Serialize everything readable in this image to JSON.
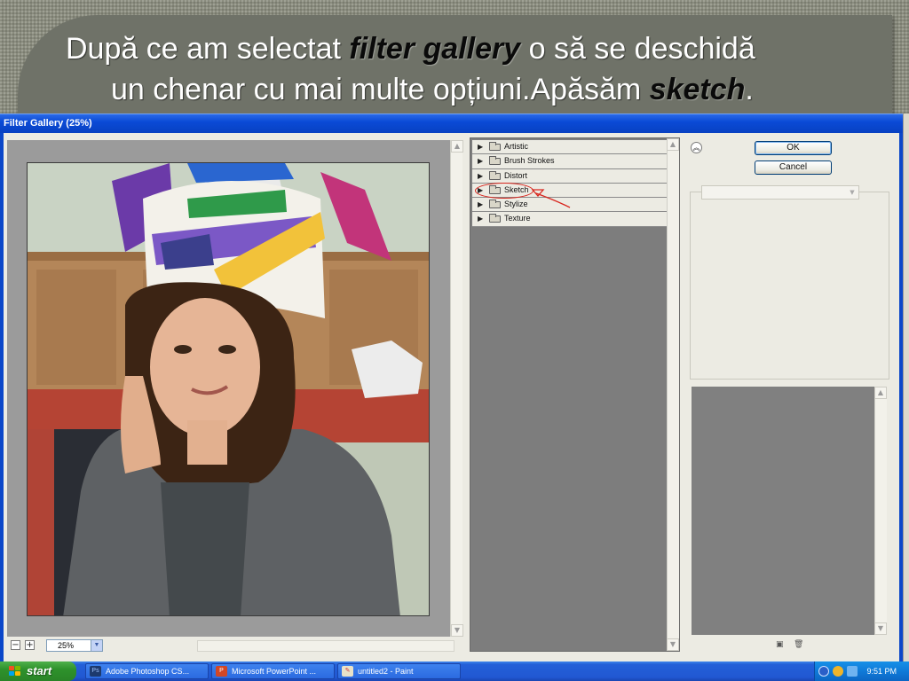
{
  "slide": {
    "title_part1": "După ce am selectat ",
    "title_em1": "filter gallery",
    "title_part2": " o să se deschidă",
    "title_part3": "un chenar cu mai multe opțiuni.Apăsăm ",
    "title_em2": "sketch",
    "title_part4": "."
  },
  "dialog": {
    "title": "Filter Gallery (25%)",
    "ok_label": "OK",
    "cancel_label": "Cancel",
    "zoom_value": "25%",
    "zoom_minus": "−",
    "zoom_plus": "+"
  },
  "filter_tree": {
    "items": [
      {
        "label": "Artistic"
      },
      {
        "label": "Brush Strokes"
      },
      {
        "label": "Distort"
      },
      {
        "label": "Sketch"
      },
      {
        "label": "Stylize"
      },
      {
        "label": "Texture"
      }
    ],
    "highlighted_index": 3
  },
  "taskbar": {
    "start_label": "start",
    "tasks": [
      {
        "label": "Adobe Photoshop CS...",
        "icon": "photoshop-icon"
      },
      {
        "label": "Microsoft PowerPoint ...",
        "icon": "powerpoint-icon"
      },
      {
        "label": "untitled2 - Paint",
        "icon": "paint-icon"
      }
    ],
    "clock": "9:51 PM"
  },
  "colors": {
    "accent_blue": "#0a4ad6",
    "annotation_red": "#d8261e",
    "start_green": "#2e922c"
  }
}
